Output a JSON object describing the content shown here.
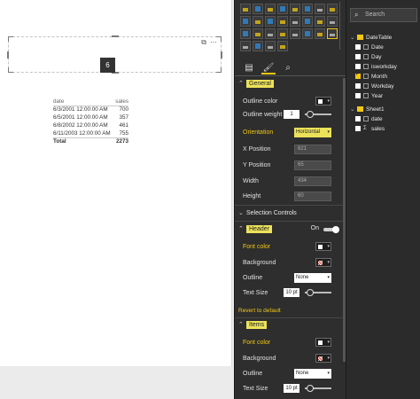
{
  "slicer": {
    "selected_value": "6",
    "focus_icon": "focus-mode-icon",
    "more_icon": "ellipsis-icon"
  },
  "table": {
    "headers": [
      "date",
      "sales"
    ],
    "rows": [
      [
        "6/3/2001 12:00:00 AM",
        "700"
      ],
      [
        "6/5/2001 12:00:00 AM",
        "357"
      ],
      [
        "6/8/2002 12:00:00 AM",
        "461"
      ],
      [
        "6/11/2003 12:00:00 AM",
        "755"
      ]
    ],
    "total_label": "Total",
    "total_value": "2273"
  },
  "format_pane": {
    "sections": {
      "general": "General",
      "selection_controls": "Selection Controls",
      "header": "Header",
      "header_state": "On",
      "items": "Items"
    },
    "general": {
      "outline_color_label": "Outline color",
      "outline_weight_label": "Outline weight",
      "outline_weight_value": "1",
      "orientation_label": "Orientation",
      "orientation_value": "Horizontal",
      "x_label": "X Position",
      "x_value": "821",
      "y_label": "Y Position",
      "y_value": "65",
      "width_label": "Width",
      "width_value": "434",
      "height_label": "Height",
      "height_value": "60"
    },
    "header": {
      "font_color_label": "Font color",
      "background_label": "Background",
      "outline_label": "Outline",
      "outline_value": "None",
      "text_size_label": "Text Size",
      "text_size_value": "10 pt"
    },
    "revert": "Revert to default",
    "items": {
      "font_color_label": "Font color",
      "background_label": "Background",
      "outline_label": "Outline",
      "outline_value": "None",
      "text_size_label": "Text Size",
      "text_size_value": "10 pt"
    },
    "accent_color": "#F2C811"
  },
  "fields_pane": {
    "search_placeholder": "Search",
    "tables": [
      {
        "name": "DateTable",
        "fields": [
          {
            "name": "Date",
            "checked": false
          },
          {
            "name": "Day",
            "checked": false
          },
          {
            "name": "isworkday",
            "checked": false
          },
          {
            "name": "Month",
            "checked": true
          },
          {
            "name": "Workday",
            "checked": false
          },
          {
            "name": "Year",
            "checked": false
          }
        ]
      },
      {
        "name": "Sheet1",
        "fields": [
          {
            "name": "date",
            "checked": false
          },
          {
            "name": "sales",
            "checked": false
          }
        ]
      }
    ]
  }
}
